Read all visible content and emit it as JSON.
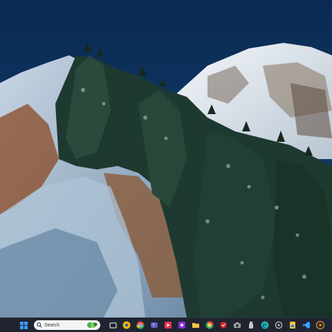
{
  "wallpaper": {
    "description_colors": {
      "sky": "#0b2c55",
      "snow": "#eef3f7",
      "trees": "#1d3b2f",
      "rock": "#8a5b3a"
    }
  },
  "taskbar": {
    "search": {
      "placeholder": "Search"
    },
    "icons": [
      {
        "name": "windows-start-icon",
        "color": "#3b9cff"
      },
      {
        "name": "search-icon",
        "color": "#333333"
      },
      {
        "name": "task-view-icon",
        "color": "#d8d8d8"
      },
      {
        "name": "chrome-canary-icon",
        "color": "#f2b400"
      },
      {
        "name": "chrome-icon",
        "color": "#e34133"
      },
      {
        "name": "teams-icon",
        "color": "#5b5fc7"
      },
      {
        "name": "media-player-icon",
        "color": "#e8344e"
      },
      {
        "name": "app-purple-icon",
        "color": "#8a2be2"
      },
      {
        "name": "file-explorer-icon",
        "color": "#f5c242"
      },
      {
        "name": "chrome-alt-icon",
        "color": "#34a853"
      },
      {
        "name": "security-icon",
        "color": "#d9262c"
      },
      {
        "name": "camera-icon",
        "color": "#9aa0a6"
      },
      {
        "name": "usb-icon",
        "color": "#c8c8c8"
      },
      {
        "name": "edge-icon",
        "color": "#1fb4a0"
      },
      {
        "name": "settings-icon",
        "color": "#bfbfbf"
      },
      {
        "name": "sticky-notes-icon",
        "color": "#f6c343"
      },
      {
        "name": "vscode-icon",
        "color": "#3aa0ff"
      },
      {
        "name": "media-icon",
        "color": "#e6a23c"
      }
    ]
  }
}
